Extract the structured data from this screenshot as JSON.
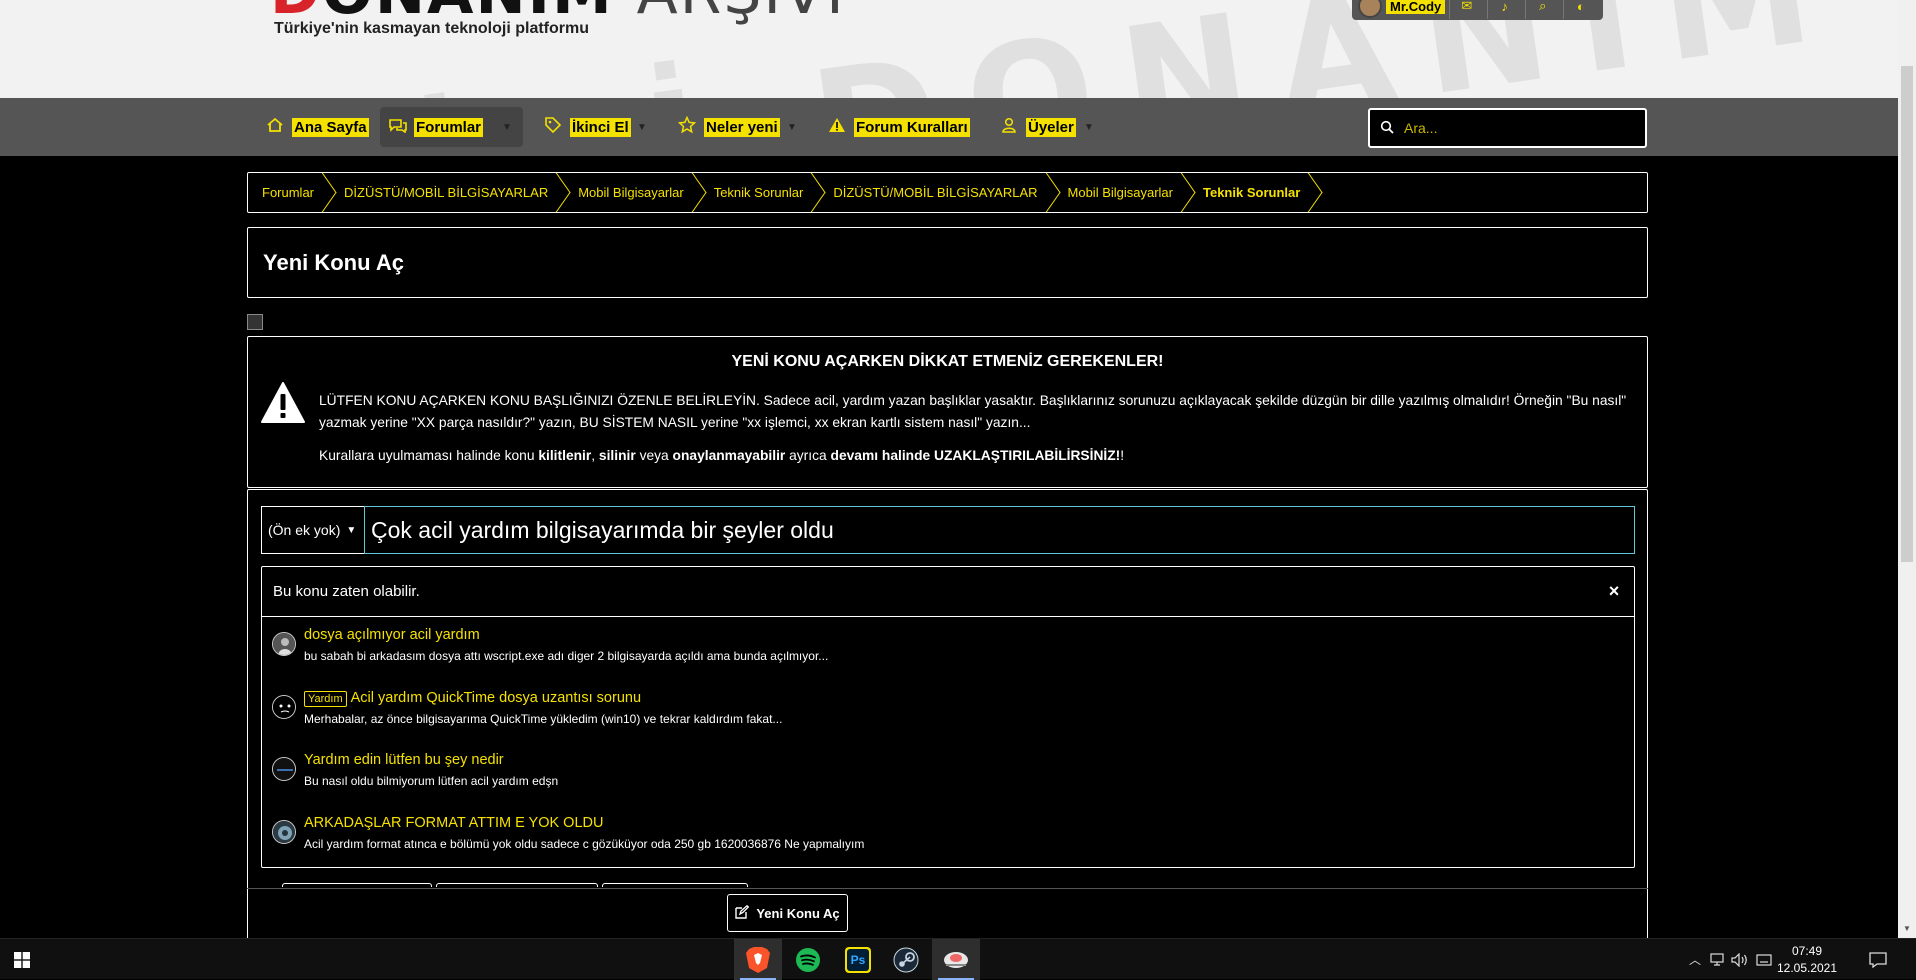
{
  "header": {
    "logo_red": "D",
    "logo_dark": "ONANIM",
    "logo_light": "ARŞİVİ",
    "tagline": "Türkiye'nin kasmayan teknoloji platformu",
    "watermark": "ARŞİVİ DONANIM ARŞİVİ",
    "username": "Mr.Cody"
  },
  "nav": {
    "items": [
      {
        "label": "Ana Sayfa",
        "icon": "home-icon"
      },
      {
        "label": "Forumlar",
        "icon": "comments-icon"
      },
      {
        "label": "İkinci El",
        "icon": "tag-icon"
      },
      {
        "label": "Neler yeni",
        "icon": "star-icon"
      },
      {
        "label": "Forum Kuralları",
        "icon": "warning-icon"
      },
      {
        "label": "Üyeler",
        "icon": "user-icon"
      }
    ],
    "search_placeholder": "Ara..."
  },
  "breadcrumb": [
    "Forumlar",
    "DİZÜSTÜ/MOBİL BİLGİSAYARLAR",
    "Mobil Bilgisayarlar",
    "Teknik Sorunlar",
    "DİZÜSTÜ/MOBİL BİLGİSAYARLAR",
    "Mobil Bilgisayarlar",
    "Teknik Sorunlar"
  ],
  "page_title": "Yeni Konu Aç",
  "notice": {
    "heading": "YENİ KONU AÇARKEN DİKKAT ETMENİZ GEREKENLER!",
    "line1": "LÜTFEN KONU AÇARKEN KONU BAŞLIĞINIZI ÖZENLE BELİRLEYİN. Sadece acil, yardım yazan başlıklar yasaktır. Başlıklarınız sorunuzu açıklayacak şekilde düzgün bir dille yazılmış olmalıdır! Örneğin \"Bu nasıl\" yazmak yerine \"XX parça nasıldır?\" yazın, BU SİSTEM NASIL yerine \"xx işlemci, xx ekran kartlı sistem nasıl\" yazın...",
    "line2_parts": [
      "Kurallara uyulmaması halinde konu ",
      "kilitlenir",
      ", ",
      "silinir",
      " veya ",
      "onaylanmayabilir",
      " ayrıca ",
      "devamı halinde UZAKLAŞTIRILABİLİRSİNİZ!",
      "!"
    ]
  },
  "form": {
    "prefix": "(Ön ek yok)",
    "title_value": "Çok acil yardım bilgisayarımda bir şeyler oldu"
  },
  "similar": {
    "title": "Bu konu zaten olabilir.",
    "close": "×",
    "threads": [
      {
        "badge": "",
        "title": "dosya açılmıyor acil yardım",
        "snippet": "bu sabah bi arkadasım dosya attı wscript.exe adı diger 2 bilgisayarda açıldı ama bunda açılmıyor..."
      },
      {
        "badge": "Yardım",
        "title": "Acil yardım QuickTime dosya uzantısı sorunu",
        "snippet": "Merhabalar, az önce bilgisayarıma QuickTime yükledim (win10) ve tekrar kaldırdım fakat..."
      },
      {
        "badge": "",
        "title": "Yardım edin lütfen bu şey nedir",
        "snippet": "Bu nasıl oldu bilmiyorum lütfen acil yardım edşn"
      },
      {
        "badge": "",
        "title": "ARKADAŞLAR FORMAT ATTIM E YOK OLDU",
        "snippet": "Acil yardım format atınca e bölümü yok oldu sadece c gözüküyor oda 250 gb 1620036876 Ne yapmalıyım"
      }
    ]
  },
  "submit_label": "Yeni Konu Aç",
  "taskbar": {
    "apps": [
      {
        "name": "brave",
        "glyph": "",
        "color": "#fb542b"
      },
      {
        "name": "spotify",
        "glyph": "",
        "color": "#1db954"
      },
      {
        "name": "photoshop",
        "glyph": "Ps",
        "color": "#31a8ff"
      },
      {
        "name": "steam",
        "glyph": "",
        "color": "#1b2838"
      },
      {
        "name": "discord-like",
        "glyph": "",
        "color": "#e66"
      }
    ],
    "time": "07:49",
    "date": "12.05.2021"
  },
  "colors": {
    "accent": "#f5e100",
    "nav_bg": "#555555",
    "input_focus": "#5fc8d8"
  }
}
